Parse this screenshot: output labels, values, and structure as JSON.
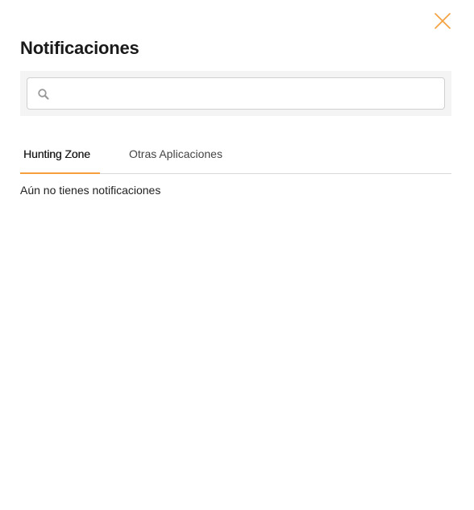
{
  "header": {
    "title": "Notificaciones",
    "close_icon": "close-icon"
  },
  "search": {
    "placeholder": "",
    "value": "",
    "icon": "search-icon"
  },
  "tabs": [
    {
      "label": "Hunting Zone",
      "active": true
    },
    {
      "label": "Otras Aplicaciones",
      "active": false
    }
  ],
  "content": {
    "empty_message": "Aún no tienes notificaciones"
  },
  "colors": {
    "accent": "#f5a03c",
    "search_background": "#f4f4f4",
    "divider": "#d9d9d9"
  }
}
